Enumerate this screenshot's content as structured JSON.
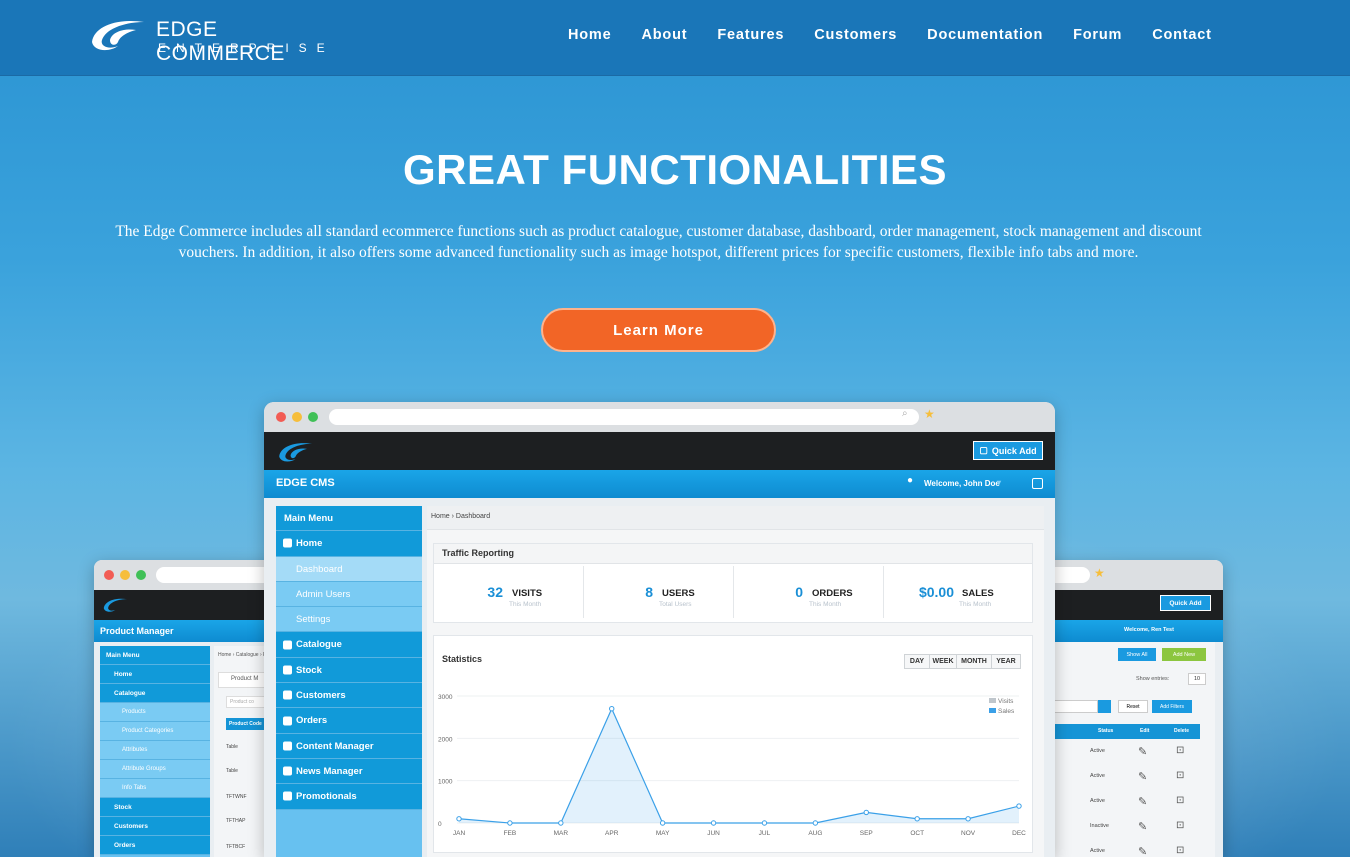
{
  "brand": {
    "name_line1": "EDGE COMMERCE",
    "name_line2": "ENTERPRISE"
  },
  "nav": [
    "Home",
    "About",
    "Features",
    "Customers",
    "Documentation",
    "Forum",
    "Contact"
  ],
  "hero": {
    "title": "GREAT FUNCTIONALITIES",
    "description": "The Edge Commerce includes all standard ecommerce functions such as product catalogue, customer database, dashboard, order management, stock management and discount vouchers. In addition, it also offers some advanced functionality such as image hotspot, different prices for specific customers, flexible info tabs and more.",
    "cta": "Learn More"
  },
  "colors": {
    "accent": "#f26526",
    "brand": "#1a76b8",
    "cms_blue": "#119ad9",
    "chart_line": "#3aa0e8"
  },
  "cms": {
    "quick_add": "Quick Add",
    "app_name": "EDGE CMS",
    "welcome": "Welcome, John Doe",
    "breadcrumb": "Home › Dashboard",
    "menu": [
      {
        "label": "Main Menu",
        "kind": "header"
      },
      {
        "label": "Home",
        "kind": "dark",
        "icon": "home-icon"
      },
      {
        "label": "Dashboard",
        "kind": "sub-active"
      },
      {
        "label": "Admin Users",
        "kind": "sub"
      },
      {
        "label": "Settings",
        "kind": "sub"
      },
      {
        "label": "Catalogue",
        "kind": "dark",
        "icon": "catalogue-icon"
      },
      {
        "label": "Stock",
        "kind": "dark",
        "icon": "stock-icon"
      },
      {
        "label": "Customers",
        "kind": "dark",
        "icon": "customers-icon"
      },
      {
        "label": "Orders",
        "kind": "dark",
        "icon": "orders-icon"
      },
      {
        "label": "Content Manager",
        "kind": "dark",
        "icon": "edit-icon"
      },
      {
        "label": "News Manager",
        "kind": "dark",
        "icon": "edit-icon"
      },
      {
        "label": "Promotionals",
        "kind": "dark",
        "icon": "tag-icon"
      }
    ],
    "traffic_title": "Traffic Reporting",
    "stats": [
      {
        "num": "32",
        "label": "VISITS",
        "sub": "This Month"
      },
      {
        "num": "8",
        "label": "USERS",
        "sub": "Total Users"
      },
      {
        "num": "0",
        "label": "ORDERS",
        "sub": "This Month"
      },
      {
        "num": "$0.00",
        "label": "SALES",
        "sub": "This Month"
      }
    ],
    "statistics_title": "Statistics",
    "ranges": [
      "DAY",
      "WEEK",
      "MONTH",
      "YEAR"
    ]
  },
  "chart_data": {
    "type": "area",
    "categories": [
      "JAN",
      "FEB",
      "MAR",
      "APR",
      "MAY",
      "JUN",
      "JUL",
      "AUG",
      "SEP",
      "OCT",
      "NOV",
      "DEC"
    ],
    "series": [
      {
        "name": "Visits",
        "values": [
          0,
          0,
          0,
          0,
          0,
          0,
          0,
          0,
          0,
          0,
          0,
          0
        ]
      },
      {
        "name": "Sales",
        "values": [
          100,
          0,
          0,
          2700,
          0,
          0,
          0,
          0,
          250,
          100,
          100,
          400
        ]
      }
    ],
    "yticks": [
      "3000",
      "2000",
      "1000",
      "0"
    ],
    "ylim": [
      0,
      3000
    ],
    "legend": "top-right"
  },
  "left_window": {
    "app_name": "Product Manager",
    "breadcrumb": "Home › Catalogue › Products",
    "panel": "Product M",
    "search_placeholder": "Product co",
    "col": "Product Code",
    "menu": [
      "Main Menu",
      "Home",
      "Catalogue",
      "Products",
      "Product Categories",
      "Attributes",
      "Attribute Groups",
      "Info Tabs",
      "Stock",
      "Customers",
      "Orders"
    ],
    "rows": [
      "Table",
      "Table",
      "TFTWNF",
      "TFTHAP",
      "TFTBCF"
    ]
  },
  "right_window": {
    "quick_add": "Quick Add",
    "welcome": "Welcome, Ren Test",
    "show_all": "Show All",
    "add_new": "Add New",
    "show_entries": "Show entries:",
    "entries_value": "10",
    "reset": "Reset",
    "add_filters": "Add Filters",
    "headers": [
      "Status",
      "Edit",
      "Delete"
    ],
    "statuses": [
      "Active",
      "Active",
      "Active",
      "Inactive",
      "Active"
    ]
  }
}
